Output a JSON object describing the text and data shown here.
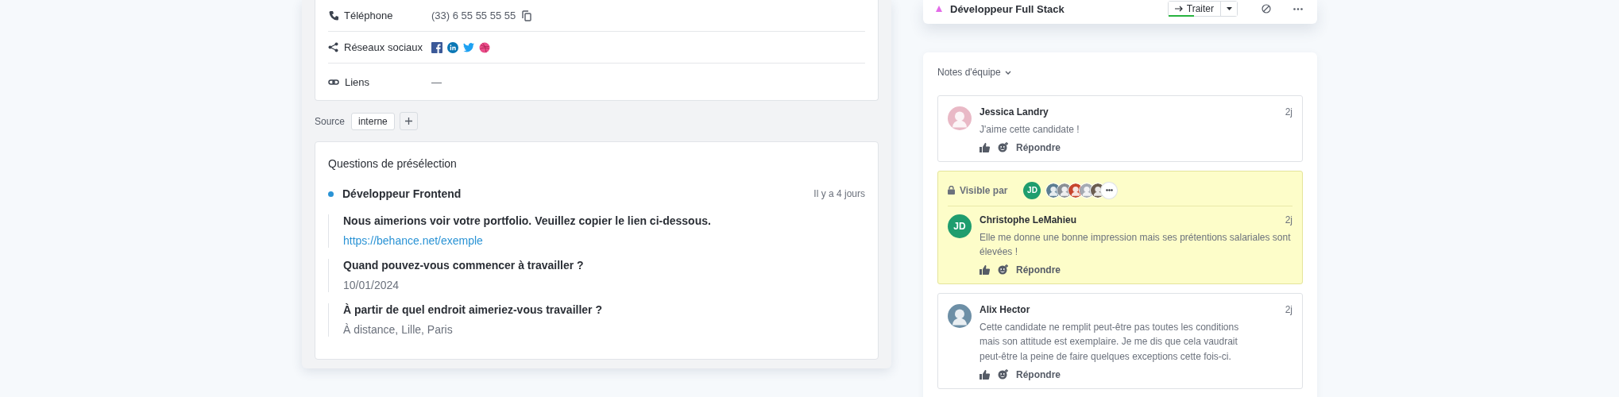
{
  "contact": {
    "rows": [
      {
        "kind": "phone",
        "label": "Téléphone",
        "value": "(33)  6 55 55 55 55"
      },
      {
        "kind": "social",
        "label": "Réseaux sociaux"
      },
      {
        "kind": "links",
        "label": "Liens",
        "value": "—"
      }
    ]
  },
  "source": {
    "label": "Source",
    "tag": "interne"
  },
  "questions": {
    "title": "Questions de présélection",
    "job": {
      "title": "Développeur Frontend",
      "time": "Il y a 4 jours"
    },
    "items": [
      {
        "question": "Nous aimerions voir votre portfolio. Veuillez copier le lien ci-dessous.",
        "answer": "https://behance.net/exemple",
        "kind": "link"
      },
      {
        "question": "Quand pouvez-vous commencer à travailler ?",
        "answer": "10/01/2024",
        "kind": "text"
      },
      {
        "question": "À partir de quel endroit aimeriez-vous travailler ?",
        "answer": "À distance, Lille, Paris",
        "kind": "text"
      }
    ]
  },
  "job_card": {
    "title": "Développeur Full Stack",
    "action": "Traiter",
    "level": 0.5
  },
  "notes": {
    "title": "Notes d'équipe",
    "items": [
      {
        "author": "Jessica Landry",
        "kind": "photo",
        "time": "2j",
        "text": "J'aime cette candidate !",
        "reply": "Répondre",
        "private": false
      },
      {
        "author": "Christophe LeMahieu",
        "kind": "initials",
        "initials": "JD",
        "color": "#1f9d6e",
        "time": "2j",
        "text": "Elle me donne une bonne impression mais ses prétentions salariales sont élevées !",
        "reply": "Répondre",
        "private": true,
        "visible_label": "Visible par",
        "viewer_initials": "JD"
      },
      {
        "author": "Alix Hector",
        "kind": "photo",
        "time": "2j",
        "text": "Cette candidate ne remplit peut-être pas toutes les conditions mais son attitude est exemplaire. Je me dis que cela vaudrait peut-être la peine de faire quelques exceptions cette fois-ci.",
        "reply": "Répondre",
        "private": false
      }
    ]
  }
}
